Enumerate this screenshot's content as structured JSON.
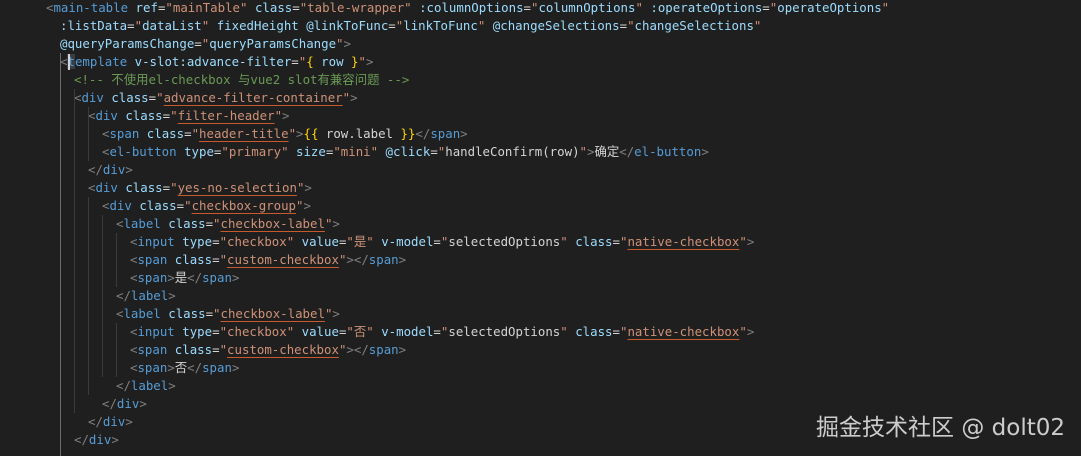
{
  "watermark": "掘金技术社区 @ dolt02",
  "lines": [
    [
      [
        "t-punc",
        "<"
      ],
      [
        "t-tag",
        "main-table"
      ],
      [
        "t-text",
        " "
      ],
      [
        "t-attr",
        "ref"
      ],
      [
        "t-text",
        "="
      ],
      [
        "t-str",
        "\"mainTable\""
      ],
      [
        "t-text",
        " "
      ],
      [
        "t-attr",
        "class"
      ],
      [
        "t-text",
        "="
      ],
      [
        "t-str",
        "\"table-wrapper\""
      ],
      [
        "t-text",
        " "
      ],
      [
        "t-attr",
        ":columnOptions"
      ],
      [
        "t-text",
        "="
      ],
      [
        "t-str",
        "\""
      ],
      [
        "t-attr",
        "columnOptions"
      ],
      [
        "t-str",
        "\""
      ],
      [
        "t-text",
        " "
      ],
      [
        "t-attr",
        ":operateOptions"
      ],
      [
        "t-text",
        "="
      ],
      [
        "t-str",
        "\""
      ],
      [
        "t-attr",
        "operateOptions"
      ],
      [
        "t-str",
        "\""
      ]
    ],
    [
      [
        "t-attr",
        ":listData"
      ],
      [
        "t-text",
        "="
      ],
      [
        "t-str",
        "\""
      ],
      [
        "t-attr",
        "dataList"
      ],
      [
        "t-str",
        "\""
      ],
      [
        "t-text",
        " "
      ],
      [
        "t-attr",
        "fixedHeight"
      ],
      [
        "t-text",
        " "
      ],
      [
        "t-attr",
        "@linkToFunc"
      ],
      [
        "t-text",
        "="
      ],
      [
        "t-str",
        "\""
      ],
      [
        "t-attr",
        "linkToFunc"
      ],
      [
        "t-str",
        "\""
      ],
      [
        "t-text",
        " "
      ],
      [
        "t-attr",
        "@changeSelections"
      ],
      [
        "t-text",
        "="
      ],
      [
        "t-str",
        "\""
      ],
      [
        "t-attr",
        "changeSelections"
      ],
      [
        "t-str",
        "\""
      ]
    ],
    [
      [
        "t-attr",
        "@queryParamsChange"
      ],
      [
        "t-text",
        "="
      ],
      [
        "t-str",
        "\""
      ],
      [
        "t-attr",
        "queryParamsChange"
      ],
      [
        "t-str",
        "\""
      ],
      [
        "t-punc",
        ">"
      ]
    ],
    [
      [
        "t-punc",
        "<"
      ],
      [
        "t-tag t-hl",
        "t"
      ],
      [
        "t-tag",
        "emplate"
      ],
      [
        "t-text",
        " "
      ],
      [
        "t-attr",
        "v-slot:advance-filter"
      ],
      [
        "t-text",
        "="
      ],
      [
        "t-str",
        "\""
      ],
      [
        "t-mus",
        "{"
      ],
      [
        "t-text",
        " "
      ],
      [
        "t-attr",
        "row"
      ],
      [
        "t-text",
        " "
      ],
      [
        "t-mus",
        "}"
      ],
      [
        "t-str",
        "\""
      ],
      [
        "t-punc",
        ">"
      ]
    ],
    [
      [
        "t-comment",
        "<!-- 不使用el-checkbox 与vue2 slot有兼容问题 -->"
      ]
    ],
    [
      [
        "t-punc",
        "<"
      ],
      [
        "t-tag",
        "div"
      ],
      [
        "t-text",
        " "
      ],
      [
        "t-attr",
        "class"
      ],
      [
        "t-text",
        "="
      ],
      [
        "t-str",
        "\""
      ],
      [
        "t-ul",
        "advance-filter-container"
      ],
      [
        "t-str",
        "\""
      ],
      [
        "t-punc",
        ">"
      ]
    ],
    [
      [
        "t-punc",
        "<"
      ],
      [
        "t-tag",
        "div"
      ],
      [
        "t-text",
        " "
      ],
      [
        "t-attr",
        "class"
      ],
      [
        "t-text",
        "="
      ],
      [
        "t-str",
        "\""
      ],
      [
        "t-ul",
        "filter-header"
      ],
      [
        "t-str",
        "\""
      ],
      [
        "t-punc",
        ">"
      ]
    ],
    [
      [
        "t-punc",
        "<"
      ],
      [
        "t-tag",
        "span"
      ],
      [
        "t-text",
        " "
      ],
      [
        "t-attr",
        "class"
      ],
      [
        "t-text",
        "="
      ],
      [
        "t-str",
        "\""
      ],
      [
        "t-ul",
        "header-title"
      ],
      [
        "t-str",
        "\""
      ],
      [
        "t-punc",
        ">"
      ],
      [
        "t-mus",
        "{{"
      ],
      [
        "t-text",
        " row.label "
      ],
      [
        "t-mus",
        "}}"
      ],
      [
        "t-punc",
        "</"
      ],
      [
        "t-tag",
        "span"
      ],
      [
        "t-punc",
        ">"
      ]
    ],
    [
      [
        "t-punc",
        "<"
      ],
      [
        "t-tag",
        "el-button"
      ],
      [
        "t-text",
        " "
      ],
      [
        "t-attr",
        "type"
      ],
      [
        "t-text",
        "="
      ],
      [
        "t-str",
        "\"primary\""
      ],
      [
        "t-text",
        " "
      ],
      [
        "t-attr",
        "size"
      ],
      [
        "t-text",
        "="
      ],
      [
        "t-str",
        "\"mini\""
      ],
      [
        "t-text",
        " "
      ],
      [
        "t-attr",
        "@click"
      ],
      [
        "t-text",
        "="
      ],
      [
        "t-str",
        "\""
      ],
      [
        "t-text",
        "handleConfirm(row)"
      ],
      [
        "t-str",
        "\""
      ],
      [
        "t-punc",
        ">"
      ],
      [
        "t-text",
        "确定"
      ],
      [
        "t-punc",
        "</"
      ],
      [
        "t-tag",
        "el-button"
      ],
      [
        "t-punc",
        ">"
      ]
    ],
    [
      [
        "t-punc",
        "</"
      ],
      [
        "t-tag",
        "div"
      ],
      [
        "t-punc",
        ">"
      ]
    ],
    [
      [
        "t-punc",
        "<"
      ],
      [
        "t-tag",
        "div"
      ],
      [
        "t-text",
        " "
      ],
      [
        "t-attr",
        "class"
      ],
      [
        "t-text",
        "="
      ],
      [
        "t-str",
        "\""
      ],
      [
        "t-ul",
        "yes-no-selection"
      ],
      [
        "t-str",
        "\""
      ],
      [
        "t-punc",
        ">"
      ]
    ],
    [
      [
        "t-punc",
        "<"
      ],
      [
        "t-tag",
        "div"
      ],
      [
        "t-text",
        " "
      ],
      [
        "t-attr",
        "class"
      ],
      [
        "t-text",
        "="
      ],
      [
        "t-str",
        "\""
      ],
      [
        "t-ul",
        "checkbox-group"
      ],
      [
        "t-str",
        "\""
      ],
      [
        "t-punc",
        ">"
      ]
    ],
    [
      [
        "t-punc",
        "<"
      ],
      [
        "t-tag",
        "label"
      ],
      [
        "t-text",
        " "
      ],
      [
        "t-attr",
        "class"
      ],
      [
        "t-text",
        "="
      ],
      [
        "t-str",
        "\""
      ],
      [
        "t-ul",
        "checkbox-label"
      ],
      [
        "t-str",
        "\""
      ],
      [
        "t-punc",
        ">"
      ]
    ],
    [
      [
        "t-punc",
        "<"
      ],
      [
        "t-tag",
        "input"
      ],
      [
        "t-text",
        " "
      ],
      [
        "t-attr",
        "type"
      ],
      [
        "t-text",
        "="
      ],
      [
        "t-str",
        "\"checkbox\""
      ],
      [
        "t-text",
        " "
      ],
      [
        "t-attr",
        "value"
      ],
      [
        "t-text",
        "="
      ],
      [
        "t-str",
        "\"是\""
      ],
      [
        "t-text",
        " "
      ],
      [
        "t-attr",
        "v-model"
      ],
      [
        "t-text",
        "="
      ],
      [
        "t-str",
        "\""
      ],
      [
        "t-text",
        "selectedOptions"
      ],
      [
        "t-str",
        "\""
      ],
      [
        "t-text",
        " "
      ],
      [
        "t-attr",
        "class"
      ],
      [
        "t-text",
        "="
      ],
      [
        "t-str",
        "\""
      ],
      [
        "t-ul",
        "native-checkbox"
      ],
      [
        "t-str",
        "\""
      ],
      [
        "t-punc",
        ">"
      ]
    ],
    [
      [
        "t-punc",
        "<"
      ],
      [
        "t-tag",
        "span"
      ],
      [
        "t-text",
        " "
      ],
      [
        "t-attr",
        "class"
      ],
      [
        "t-text",
        "="
      ],
      [
        "t-str",
        "\""
      ],
      [
        "t-ul",
        "custom-checkbox"
      ],
      [
        "t-str",
        "\""
      ],
      [
        "t-punc",
        "></"
      ],
      [
        "t-tag",
        "span"
      ],
      [
        "t-punc",
        ">"
      ]
    ],
    [
      [
        "t-punc",
        "<"
      ],
      [
        "t-tag",
        "span"
      ],
      [
        "t-punc",
        ">"
      ],
      [
        "t-text",
        "是"
      ],
      [
        "t-punc",
        "</"
      ],
      [
        "t-tag",
        "span"
      ],
      [
        "t-punc",
        ">"
      ]
    ],
    [
      [
        "t-punc",
        "</"
      ],
      [
        "t-tag",
        "label"
      ],
      [
        "t-punc",
        ">"
      ]
    ],
    [
      [
        "t-punc",
        "<"
      ],
      [
        "t-tag",
        "label"
      ],
      [
        "t-text",
        " "
      ],
      [
        "t-attr",
        "class"
      ],
      [
        "t-text",
        "="
      ],
      [
        "t-str",
        "\""
      ],
      [
        "t-ul",
        "checkbox-label"
      ],
      [
        "t-str",
        "\""
      ],
      [
        "t-punc",
        ">"
      ]
    ],
    [
      [
        "t-punc",
        "<"
      ],
      [
        "t-tag",
        "input"
      ],
      [
        "t-text",
        " "
      ],
      [
        "t-attr",
        "type"
      ],
      [
        "t-text",
        "="
      ],
      [
        "t-str",
        "\"checkbox\""
      ],
      [
        "t-text",
        " "
      ],
      [
        "t-attr",
        "value"
      ],
      [
        "t-text",
        "="
      ],
      [
        "t-str",
        "\"否\""
      ],
      [
        "t-text",
        " "
      ],
      [
        "t-attr",
        "v-model"
      ],
      [
        "t-text",
        "="
      ],
      [
        "t-str",
        "\""
      ],
      [
        "t-text",
        "selectedOptions"
      ],
      [
        "t-str",
        "\""
      ],
      [
        "t-text",
        " "
      ],
      [
        "t-attr",
        "class"
      ],
      [
        "t-text",
        "="
      ],
      [
        "t-str",
        "\""
      ],
      [
        "t-ul",
        "native-checkbox"
      ],
      [
        "t-str",
        "\""
      ],
      [
        "t-punc",
        ">"
      ]
    ],
    [
      [
        "t-punc",
        "<"
      ],
      [
        "t-tag",
        "span"
      ],
      [
        "t-text",
        " "
      ],
      [
        "t-attr",
        "class"
      ],
      [
        "t-text",
        "="
      ],
      [
        "t-str",
        "\""
      ],
      [
        "t-ul",
        "custom-checkbox"
      ],
      [
        "t-str",
        "\""
      ],
      [
        "t-punc",
        "></"
      ],
      [
        "t-tag",
        "span"
      ],
      [
        "t-punc",
        ">"
      ]
    ],
    [
      [
        "t-punc",
        "<"
      ],
      [
        "t-tag",
        "span"
      ],
      [
        "t-punc",
        ">"
      ],
      [
        "t-text",
        "否"
      ],
      [
        "t-punc",
        "</"
      ],
      [
        "t-tag",
        "span"
      ],
      [
        "t-punc",
        ">"
      ]
    ],
    [
      [
        "t-punc",
        "</"
      ],
      [
        "t-tag",
        "label"
      ],
      [
        "t-punc",
        ">"
      ]
    ],
    [
      [
        "t-punc",
        "</"
      ],
      [
        "t-tag",
        "div"
      ],
      [
        "t-punc",
        ">"
      ]
    ],
    [
      [
        "t-punc",
        "</"
      ],
      [
        "t-tag",
        "div"
      ],
      [
        "t-punc",
        ">"
      ]
    ],
    [
      [
        "t-punc",
        "</"
      ],
      [
        "t-tag",
        "div"
      ],
      [
        "t-punc",
        ">"
      ]
    ]
  ]
}
